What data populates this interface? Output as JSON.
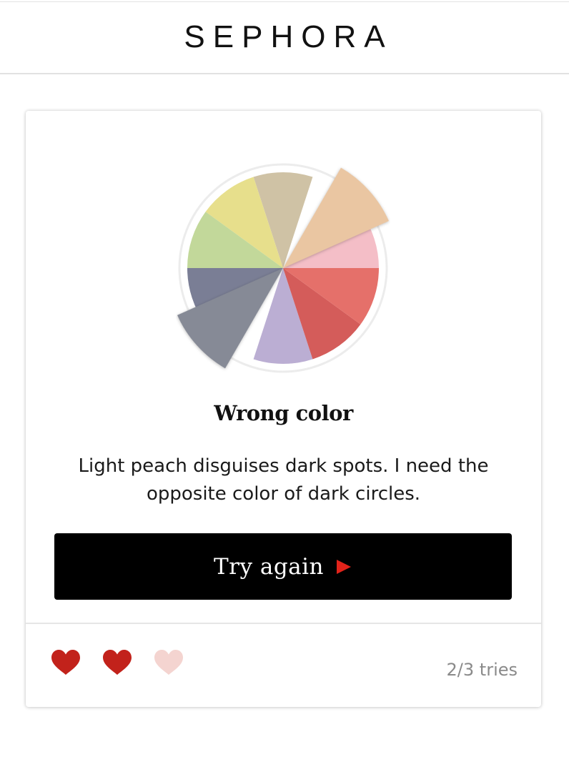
{
  "brand": {
    "logo_text": "SEPHORA"
  },
  "wheel": {
    "segments": [
      {
        "color": "#f4bec7",
        "name": "light pink",
        "popped": false
      },
      {
        "color": "#eac6a2",
        "name": "light peach",
        "popped": true
      },
      {
        "color": "#cfc2a5",
        "name": "beige",
        "popped": false
      },
      {
        "color": "#e7df8c",
        "name": "yellow",
        "popped": false
      },
      {
        "color": "#c2d89a",
        "name": "green",
        "popped": false
      },
      {
        "color": "#7a7e95",
        "name": "slate blue",
        "popped": false
      },
      {
        "color": "#868a96",
        "name": "grey",
        "popped": true
      },
      {
        "color": "#bbaed3",
        "name": "lavender",
        "popped": false
      },
      {
        "color": "#d45c5a",
        "name": "red",
        "popped": false
      },
      {
        "color": "#e5706a",
        "name": "coral",
        "popped": false
      }
    ]
  },
  "result": {
    "title": "Wrong color",
    "message": "Light peach disguises dark spots. I need the opposite color of dark circles."
  },
  "actions": {
    "retry_label": "Try again",
    "retry_arrow_color": "#e2231a"
  },
  "lives": {
    "hearts": [
      {
        "state": "full",
        "color": "#c2221b"
      },
      {
        "state": "full",
        "color": "#c2221b"
      },
      {
        "state": "empty",
        "color": "#f4d4d0"
      }
    ],
    "tries_text": "2/3 tries"
  }
}
